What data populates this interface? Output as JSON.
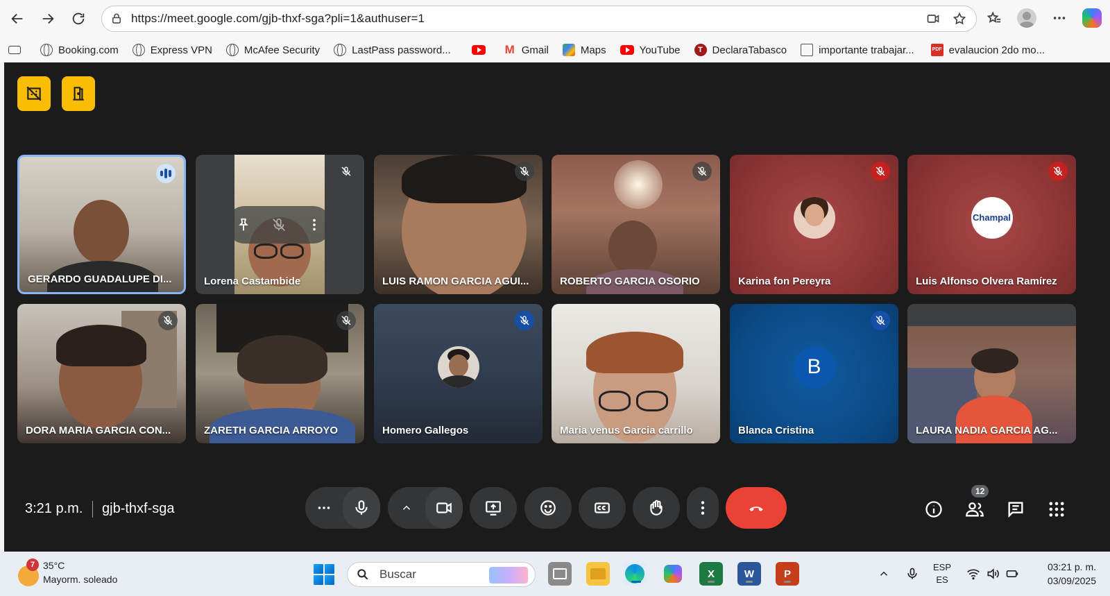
{
  "browser": {
    "url": "https://meet.google.com/gjb-thxf-sga?pli=1&authuser=1"
  },
  "bookmarks": [
    {
      "label": "Booking.com",
      "icon": "globe-icon"
    },
    {
      "label": "Express VPN",
      "icon": "globe-icon"
    },
    {
      "label": "McAfee Security",
      "icon": "globe-icon"
    },
    {
      "label": "LastPass password...",
      "icon": "globe-icon"
    },
    {
      "label": "",
      "icon": "youtube-icon"
    },
    {
      "label": "Gmail",
      "icon": "gmail-icon"
    },
    {
      "label": "Maps",
      "icon": "maps-icon"
    },
    {
      "label": "YouTube",
      "icon": "youtube-icon"
    },
    {
      "label": "DeclaraTabasco",
      "icon": "declaratabasco-icon"
    },
    {
      "label": "importante trabajar...",
      "icon": "folder-icon"
    },
    {
      "label": "evalaucion 2do mo...",
      "icon": "pdf-icon"
    }
  ],
  "participants": [
    {
      "name": "GERARDO GUADALUPE DI..."
    },
    {
      "name": "Lorena Castambide"
    },
    {
      "name": "LUIS RAMON GARCIA AGUI..."
    },
    {
      "name": "ROBERTO GARCIA OSORIO"
    },
    {
      "name": "Karina fon Pereyra"
    },
    {
      "name": "Luis Alfonso Olvera Ramírez"
    },
    {
      "name": "DORA MARIA GARCIA CON..."
    },
    {
      "name": "ZARETH GARCIA ARROYO"
    },
    {
      "name": "Homero Gallegos"
    },
    {
      "name": "Maria venus Garcia carrillo"
    },
    {
      "name": "Blanca Cristina",
      "initial": "B"
    },
    {
      "name": "LAURA NADIA GARCIA AG..."
    }
  ],
  "champal_logo": "Champal",
  "meeting": {
    "time": "3:21 p.m.",
    "code": "gjb-thxf-sga",
    "participant_count": "12"
  },
  "colors": {
    "hangup": "#ea4335",
    "yellow_button": "#fbbc04",
    "active_border": "#8ab4f8"
  },
  "taskbar": {
    "weather_badge": "7",
    "temp": "35°C",
    "weather_desc": "Mayorm. soleado",
    "search_placeholder": "Buscar",
    "lang_top": "ESP",
    "lang_bottom": "ES",
    "clock_time": "03:21 p. m.",
    "clock_date": "03/09/2025",
    "excel": "X",
    "word": "W",
    "powerpoint": "P"
  }
}
